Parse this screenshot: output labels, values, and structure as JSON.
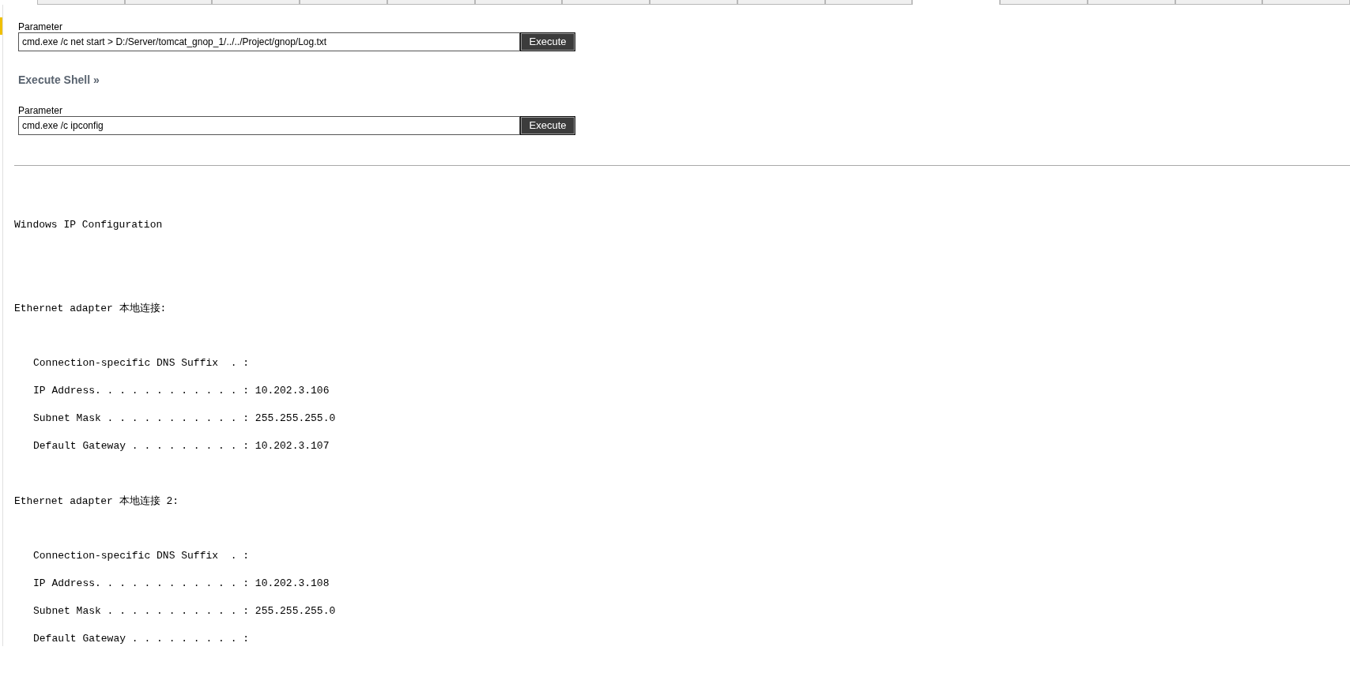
{
  "tabs": [
    {
      "selected": false
    },
    {
      "selected": false
    },
    {
      "selected": false
    },
    {
      "selected": false
    },
    {
      "selected": false
    },
    {
      "selected": false
    },
    {
      "selected": false
    },
    {
      "selected": false
    },
    {
      "selected": false
    },
    {
      "selected": false
    },
    {
      "selected": true
    },
    {
      "selected": false
    },
    {
      "selected": false
    },
    {
      "selected": false
    },
    {
      "selected": false
    }
  ],
  "forms": [
    {
      "label": "Parameter",
      "value": "cmd.exe /c net start > D:/Server/tomcat_gnop_1/../../Project/gnop/Log.txt",
      "button": "Execute"
    },
    {
      "heading": "Execute Shell »",
      "label": "Parameter",
      "value": "cmd.exe /c ipconfig",
      "button": "Execute"
    }
  ],
  "output": {
    "title": "Windows IP Configuration",
    "adapters": [
      {
        "name": "Ethernet adapter 本地连接:",
        "lines": [
          "Connection-specific DNS Suffix  . :",
          "IP Address. . . . . . . . . . . . : 10.202.3.106",
          "Subnet Mask . . . . . . . . . . . : 255.255.255.0",
          "Default Gateway . . . . . . . . . : 10.202.3.107"
        ]
      },
      {
        "name": "Ethernet adapter 本地连接 2:",
        "lines": [
          "Connection-specific DNS Suffix  . :",
          "IP Address. . . . . . . . . . . . : 10.202.3.108",
          "Subnet Mask . . . . . . . . . . . : 255.255.255.0",
          "Default Gateway . . . . . . . . . :"
        ]
      }
    ]
  }
}
